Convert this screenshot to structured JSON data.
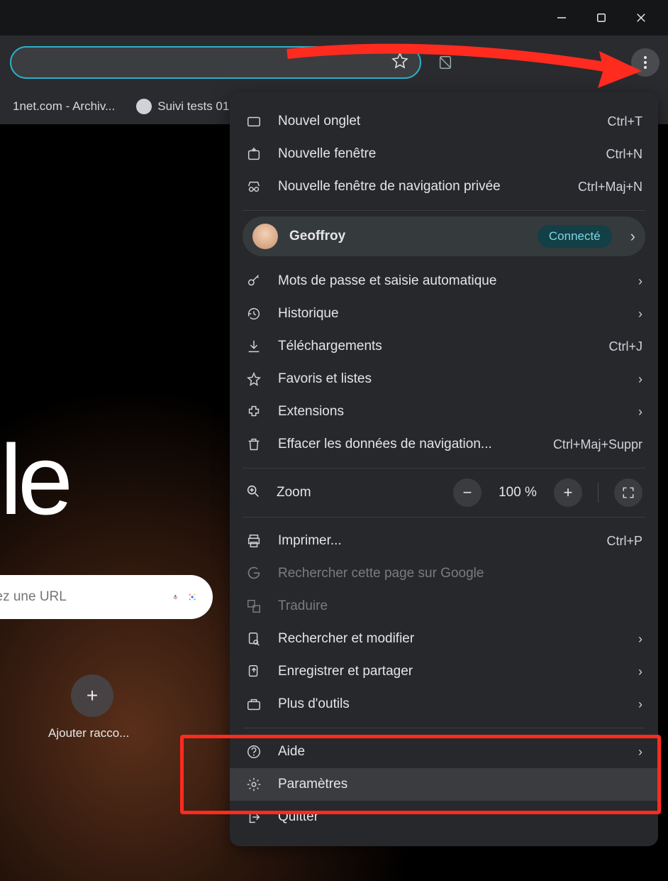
{
  "toolbar": {
    "titlebar": {},
    "bookmarks": [
      {
        "label": "1net.com - Archiv..."
      },
      {
        "label": "Suivi tests 01"
      }
    ]
  },
  "content": {
    "logo_fragment": "le",
    "search_placeholder": "sez une URL",
    "add_shortcut_label": "Ajouter racco..."
  },
  "menu": {
    "new_tab": {
      "label": "Nouvel onglet",
      "kbd": "Ctrl+T"
    },
    "new_window": {
      "label": "Nouvelle fenêtre",
      "kbd": "Ctrl+N"
    },
    "incognito": {
      "label": "Nouvelle fenêtre de navigation privée",
      "kbd": "Ctrl+Maj+N"
    },
    "profile": {
      "name": "Geoffroy",
      "status": "Connecté"
    },
    "passwords": {
      "label": "Mots de passe et saisie automatique"
    },
    "history": {
      "label": "Historique"
    },
    "downloads": {
      "label": "Téléchargements",
      "kbd": "Ctrl+J"
    },
    "bookmarks": {
      "label": "Favoris et listes"
    },
    "extensions": {
      "label": "Extensions"
    },
    "clear_data": {
      "label": "Effacer les données de navigation...",
      "kbd": "Ctrl+Maj+Suppr"
    },
    "zoom": {
      "label": "Zoom",
      "value": "100 %"
    },
    "print": {
      "label": "Imprimer...",
      "kbd": "Ctrl+P"
    },
    "search_google": {
      "label": "Rechercher cette page sur Google"
    },
    "translate": {
      "label": "Traduire"
    },
    "find_edit": {
      "label": "Rechercher et modifier"
    },
    "save_share": {
      "label": "Enregistrer et partager"
    },
    "more_tools": {
      "label": "Plus d'outils"
    },
    "help": {
      "label": "Aide"
    },
    "settings": {
      "label": "Paramètres"
    },
    "exit": {
      "label": "Quitter"
    }
  }
}
